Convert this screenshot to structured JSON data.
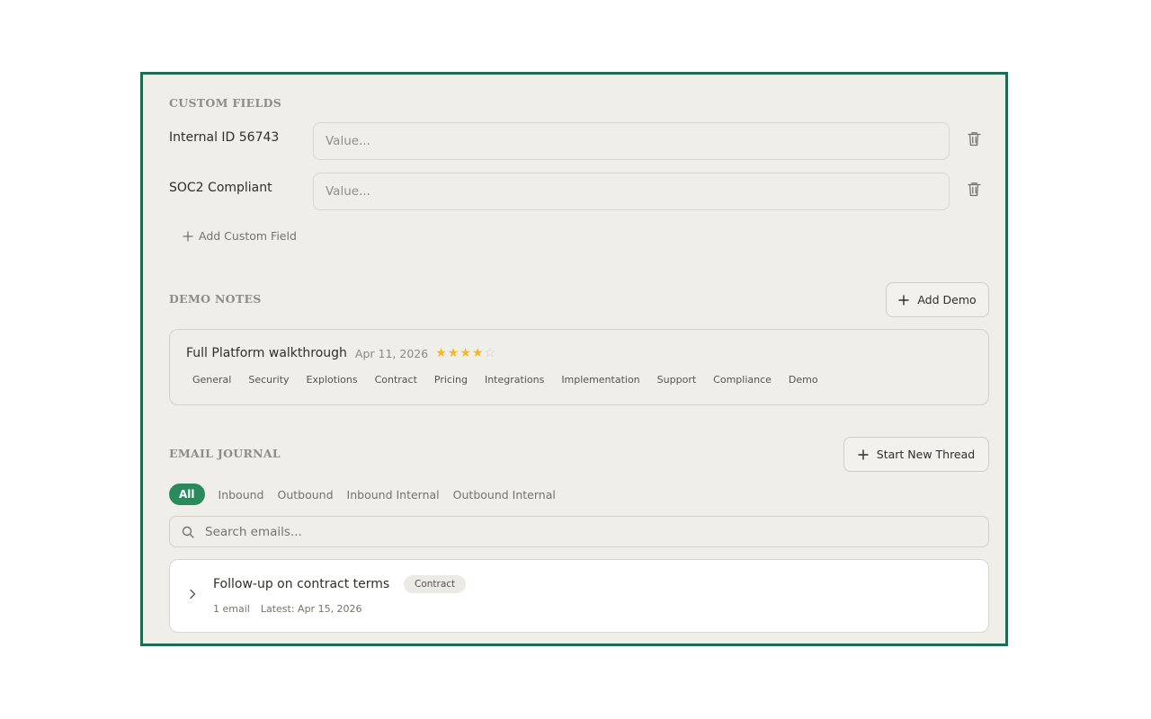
{
  "custom_fields": {
    "title": "CUSTOM FIELDS",
    "fields": [
      {
        "label": "Internal ID 56743",
        "value": "",
        "placeholder": "Value..."
      },
      {
        "label": "SOC2 Compliant",
        "value": "",
        "placeholder": "Value..."
      }
    ],
    "delete_icon": "trash-icon",
    "add_label": "Add Custom Field"
  },
  "demo_notes": {
    "title": "DEMO NOTES",
    "add_label": "Add Demo",
    "note": {
      "title": "Full Platform walkthrough",
      "date": "Apr 11, 2026",
      "rating": 4,
      "rating_max": 5,
      "tags": [
        "General",
        "Security",
        "Explotions",
        "Contract",
        "Pricing",
        "Integrations",
        "Implementation",
        "Support",
        "Compliance",
        "Demo"
      ]
    }
  },
  "email_journal": {
    "title": "EMAIL JOURNAL",
    "new_thread_label": "Start New Thread",
    "filters": [
      "All",
      "Inbound",
      "Outbound",
      "Inbound Internal",
      "Outbound Internal"
    ],
    "active_filter": "All",
    "search_placeholder": "Search emails...",
    "threads": [
      {
        "subject": "Follow-up on contract terms",
        "tag": "Contract",
        "count": "1 email",
        "latest": "Latest: Apr 15, 2026"
      }
    ]
  },
  "colors": {
    "frame": "#1f6b52",
    "accent": "#2a8a5e",
    "star": "#f2b925",
    "panel_bg": "#efeee9"
  }
}
